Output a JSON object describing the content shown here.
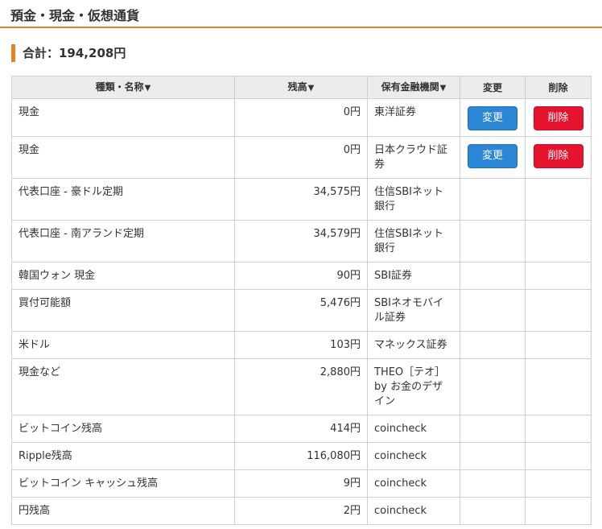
{
  "section": {
    "title": "預金・現金・仮想通貨"
  },
  "summary": {
    "total_label": "合計：194,208円"
  },
  "table": {
    "headers": {
      "name": "種類・名称",
      "balance": "残高",
      "institution": "保有金融機関",
      "edit": "変更",
      "delete": "削除"
    },
    "sort_arrow": "▼",
    "edit_label": "変更",
    "delete_label": "削除",
    "rows": [
      {
        "name": "現金",
        "balance": "0円",
        "institution": "東洋証券"
      },
      {
        "name": "現金",
        "balance": "0円",
        "institution": "日本クラウド証券"
      },
      {
        "name": "代表口座 - 豪ドル定期",
        "balance": "34,575円",
        "institution": "住信SBIネット銀行"
      },
      {
        "name": "代表口座 - 南アランド定期",
        "balance": "34,579円",
        "institution": "住信SBIネット銀行"
      },
      {
        "name": "韓国ウォン 現金",
        "balance": "90円",
        "institution": "SBI証券"
      },
      {
        "name": "買付可能額",
        "balance": "5,476円",
        "institution": "SBIネオモバイル証券"
      },
      {
        "name": "米ドル",
        "balance": "103円",
        "institution": "マネックス証券"
      },
      {
        "name": "現金など",
        "balance": "2,880円",
        "institution": "THEO［テオ］by お金のデザイン"
      },
      {
        "name": "ビットコイン残高",
        "balance": "414円",
        "institution": "coincheck"
      },
      {
        "name": "Ripple残高",
        "balance": "116,080円",
        "institution": "coincheck"
      },
      {
        "name": "ビットコイン キャッシュ残高",
        "balance": "9円",
        "institution": "coincheck"
      },
      {
        "name": "円残高",
        "balance": "2円",
        "institution": "coincheck"
      }
    ]
  },
  "colors": {
    "accent": "#e8821e",
    "edit_button": "#2b86d6",
    "delete_button": "#e6132f"
  }
}
